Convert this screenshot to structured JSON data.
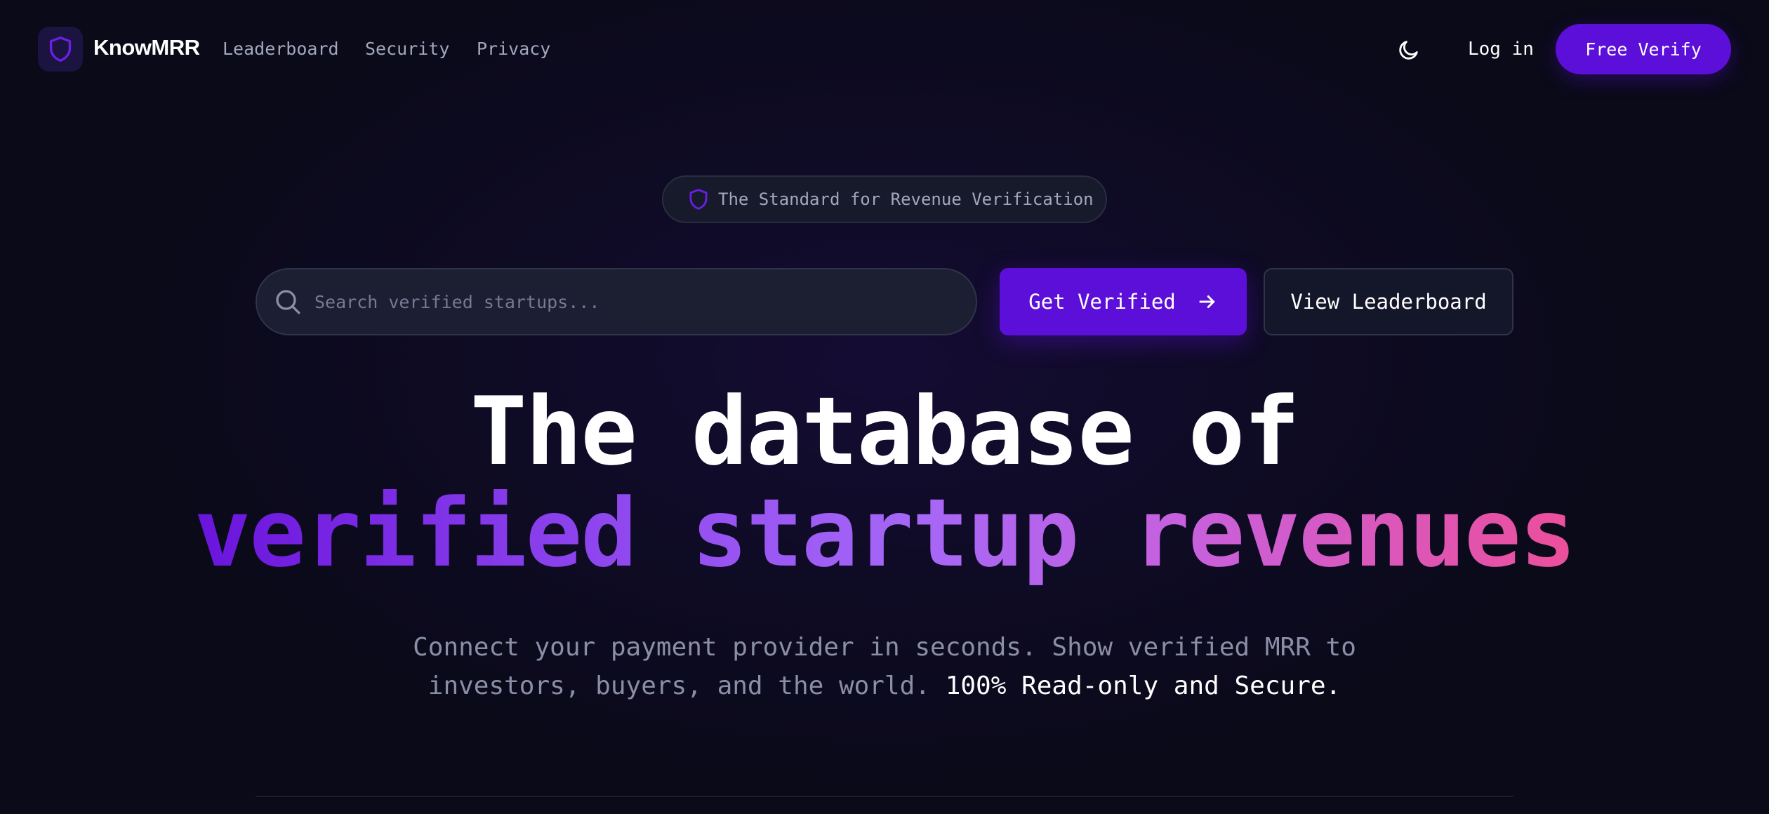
{
  "nav": {
    "brand": "KnowMRR",
    "links": [
      "Leaderboard",
      "Security",
      "Privacy"
    ],
    "login_label": "Log in",
    "cta_label": "Free Verify"
  },
  "hero": {
    "badge_text": "The Standard for Revenue Verification",
    "search_placeholder": "Search verified startups...",
    "primary_button": "Get Verified",
    "secondary_button": "View Leaderboard",
    "headline_line1": "The database of",
    "headline_line2": "verified startup revenues",
    "sub_line1": "Connect your payment provider in seconds. Show verified MRR to",
    "sub_line2_plain": "investors, buyers, and the world.",
    "sub_line2_strong": "100% Read-only and Secure."
  },
  "icons": {
    "logo": "shield-icon",
    "theme": "moon-icon",
    "badge": "shield-icon",
    "search": "search-icon",
    "arrow": "arrow-right-icon"
  },
  "colors": {
    "background": "#0a0a18",
    "accent": "#5b0fd8",
    "gradient_start": "#6a14dc",
    "gradient_mid": "#a567f7",
    "gradient_end": "#ec4f9a",
    "muted_text": "#8a8ea6"
  }
}
